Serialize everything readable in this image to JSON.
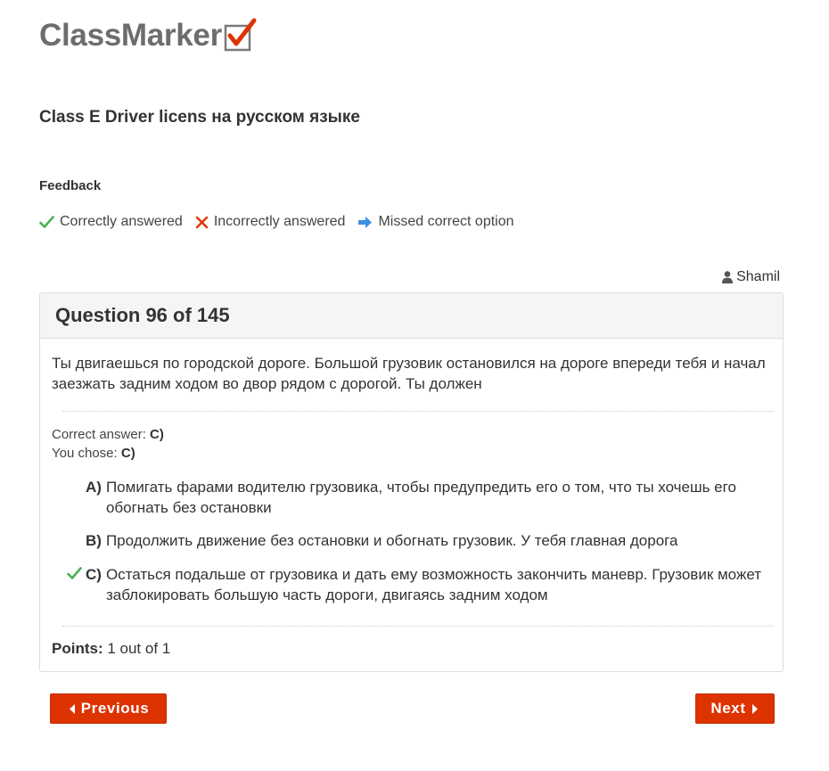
{
  "brand": {
    "logo_text": "ClassMarker",
    "accent_color": "#dd3300"
  },
  "page": {
    "title": "Class E Driver licens на русском языке"
  },
  "feedback": {
    "title": "Feedback",
    "legend": [
      {
        "icon": "check-icon",
        "label": "Correctly answered",
        "color": "#4caf50"
      },
      {
        "icon": "cross-icon",
        "label": "Incorrectly answered",
        "color": "#dd3300"
      },
      {
        "icon": "arrow-right-icon",
        "label": "Missed correct option",
        "color": "#3d8fe6"
      }
    ]
  },
  "user": {
    "icon": "user-icon",
    "name": "Shamil"
  },
  "question": {
    "heading": "Question 96 of 145",
    "text": "Ты двигаешься по городской дороге. Большой грузовик остановился на дороге впереди тебя и начал заезжать задним ходом во двор рядом с дорогой. Ты должен",
    "correct_answer_label": "Correct answer:",
    "correct_answer_value": "C)",
    "you_chose_label": "You chose:",
    "you_chose_value": "C)",
    "options": [
      {
        "letter": "A)",
        "text": "Помигать фарами водителю грузовика, чтобы предупредить его о том, что ты хочешь его обогнать без остановки",
        "mark": ""
      },
      {
        "letter": "B)",
        "text": "Продолжить движение без остановки и обогнать грузовик. У тебя главная дорога",
        "mark": ""
      },
      {
        "letter": "C)",
        "text": "Остаться подальше от грузовика и дать ему возможность закончить маневр. Грузовик может заблокировать большую часть дороги, двигаясь задним ходом",
        "mark": "check-icon"
      }
    ],
    "points_label": "Points:",
    "points_value": "1 out of 1"
  },
  "nav": {
    "previous_label": "Previous",
    "next_label": "Next"
  }
}
